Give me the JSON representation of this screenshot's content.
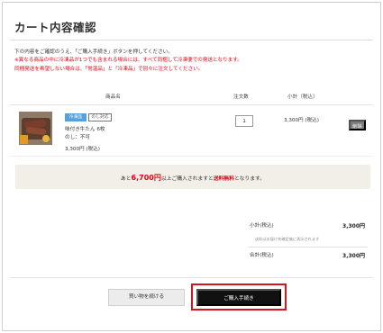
{
  "page": {
    "title": "カート内容確認"
  },
  "notices": [
    "下の内容をご確認のうえ、「ご購入手続き」ボタンを押してください。",
    "※異なる商品の中に冷凍品が1つでも含まれる場合には、すべて同梱して冷凍便での発送となります。",
    "同梱発送を希望しない場合は、「常温品」と「冷凍品」で別々に注文してください。"
  ],
  "table": {
    "headers": {
      "product": "商品名",
      "quantity": "注文数",
      "subtotal": "小計（税込）"
    }
  },
  "cart_item": {
    "badge_primary": "冷凍品",
    "badge_secondary": "のし対応",
    "name": "味付き牛たん 6枚",
    "noshi": "のし：不可",
    "price": "3,300円 (税込)",
    "quantity": "1",
    "subtotal": "3,300円 (税込)",
    "delete_label": "削除"
  },
  "shipping_notice": {
    "prefix": "あと",
    "amount": "6,700円",
    "middle": "以上ご購入されますと",
    "free": "送料無料",
    "suffix": "となります。"
  },
  "summary": {
    "subtotal_label": "小計(税込)",
    "subtotal_value": "3,300円",
    "note": "送料はお届け先確定後に表示されます",
    "total_label": "合計(税込)",
    "total_value": "3,300円"
  },
  "buttons": {
    "continue_shopping": "買い物を続ける",
    "checkout": "ご購入手続き"
  },
  "colors": {
    "accent_red": "#e60012",
    "highlight_border": "#d5141d",
    "checkout_bg": "#111111",
    "frozen_badge": "#5aa0d6",
    "shipping_box_bg": "#f2efe8"
  }
}
